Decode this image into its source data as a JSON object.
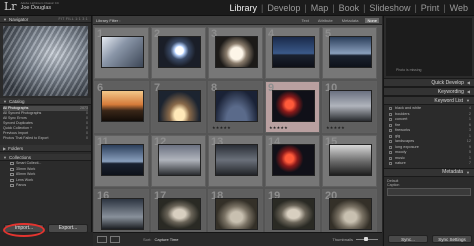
{
  "brand": {
    "logo": "Lr",
    "product": "Adobe Lightroom Classic CC",
    "user": "Joe Douglas"
  },
  "modules": {
    "items": [
      "Library",
      "Develop",
      "Map",
      "Book",
      "Slideshow",
      "Print",
      "Web"
    ],
    "active": "Library"
  },
  "left_panel": {
    "navigator": {
      "title": "Navigator",
      "zoom_options": "FIT FILL 1:1 3:1"
    },
    "catalog": {
      "title": "Catalog",
      "rows": [
        {
          "label": "All Photographs",
          "count": "2873"
        },
        {
          "label": "All Synced Photographs",
          "count": "0"
        },
        {
          "label": "All Sync Errors",
          "count": "0"
        },
        {
          "label": "Synced Duplicates",
          "count": "0"
        },
        {
          "label": "Quick Collection +",
          "count": "0"
        },
        {
          "label": "Previous Import",
          "count": "0"
        },
        {
          "label": "Photos That Failed to Export",
          "count": "0"
        }
      ]
    },
    "folders": {
      "title": "Folders"
    },
    "collections": {
      "title": "Collections",
      "rows": [
        "Smart Collecti...",
        "35mm Work",
        "85mm Work",
        "Lens Work",
        "Panos"
      ]
    },
    "buttons": {
      "import": "Import...",
      "export": "Export..."
    }
  },
  "center": {
    "filter": {
      "title": "Library Filter :",
      "options": [
        "Text",
        "Attribute",
        "Metadata",
        "None"
      ],
      "active": "None"
    },
    "grid": {
      "cells": [
        {
          "idx": "1",
          "photo": "wave",
          "stars": ""
        },
        {
          "idx": "2",
          "photo": "orb",
          "stars": ""
        },
        {
          "idx": "3",
          "photo": "book",
          "stars": ""
        },
        {
          "idx": "4",
          "photo": "city",
          "stars": ""
        },
        {
          "idx": "5",
          "photo": "pier",
          "stars": ""
        },
        {
          "idx": "6",
          "photo": "sunset",
          "stars": ""
        },
        {
          "idx": "7",
          "photo": "dome",
          "stars": ""
        },
        {
          "idx": "8",
          "photo": "stars",
          "stars": "★★★★★"
        },
        {
          "idx": "9",
          "photo": "fire",
          "stars": "★★★★★"
        },
        {
          "idx": "10",
          "photo": "bridge",
          "stars": "★★★★★"
        },
        {
          "idx": "11",
          "photo": "pier",
          "stars": ""
        },
        {
          "idx": "12",
          "photo": "bridge",
          "stars": ""
        },
        {
          "idx": "13",
          "photo": "storm",
          "stars": ""
        },
        {
          "idx": "14",
          "photo": "fire",
          "stars": ""
        },
        {
          "idx": "15",
          "photo": "bw",
          "stars": ""
        },
        {
          "idx": "16",
          "photo": "tower",
          "stars": ""
        },
        {
          "idx": "17",
          "photo": "owl",
          "stars": ""
        },
        {
          "idx": "18",
          "photo": "rabbit",
          "stars": ""
        },
        {
          "idx": "19",
          "photo": "owl",
          "stars": ""
        },
        {
          "idx": "20",
          "photo": "rabbit",
          "stars": ""
        }
      ]
    },
    "toolbar": {
      "sort_label": "Sort:",
      "sort_value": "Capture Time",
      "thumbnails_label": "Thumbnails"
    }
  },
  "right_panel": {
    "histogram": {
      "message": "Photo is missing"
    },
    "sections": {
      "quick_develop": "Quick Develop",
      "keywording": "Keywording",
      "keyword_list": "Keyword List"
    },
    "keywords": [
      {
        "label": "black and white",
        "count": "4"
      },
      {
        "label": "boulders",
        "count": "2"
      },
      {
        "label": "concert",
        "count": "1"
      },
      {
        "label": "fire",
        "count": "6"
      },
      {
        "label": "fireworks",
        "count": "3"
      },
      {
        "label": "gig",
        "count": "1"
      },
      {
        "label": "landscapes",
        "count": "12"
      },
      {
        "label": "long exposure",
        "count": "9"
      },
      {
        "label": "moody",
        "count": "5"
      },
      {
        "label": "music",
        "count": "1"
      },
      {
        "label": "nature",
        "count": "7"
      }
    ],
    "metadata": {
      "title": "Metadata",
      "preset": "Default",
      "caption": "Caption"
    },
    "buttons": {
      "sync": "Sync...",
      "sync_settings": "Sync Settings"
    }
  },
  "colors": {
    "accent_ring": "#e3342f",
    "active_module": "#f0f0f0"
  }
}
